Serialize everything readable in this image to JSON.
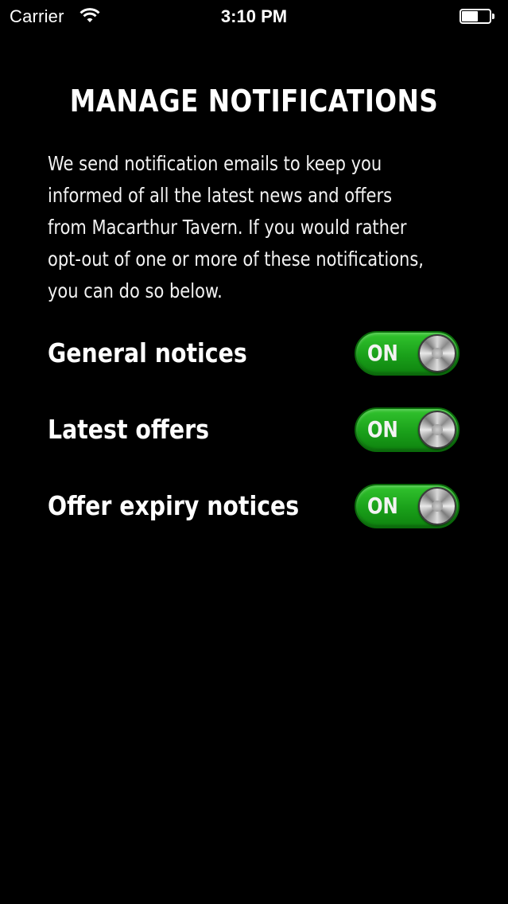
{
  "status_bar": {
    "carrier": "Carrier",
    "time": "3:10 PM",
    "wifi_icon": "wifi-icon",
    "battery_icon": "battery-icon",
    "battery_level_percent": 60
  },
  "page": {
    "title": "MANAGE NOTIFICATIONS",
    "intro_lines": [
      "We send notification emails to keep you",
      "informed of all the latest news and offers",
      "from Macarthur Tavern. If you would rather",
      "opt-out of one or more of these notifications,",
      "you can do so below."
    ]
  },
  "settings": [
    {
      "label": "General notices",
      "state": "ON",
      "enabled": true
    },
    {
      "label": "Latest offers",
      "state": "ON",
      "enabled": true
    },
    {
      "label": "Offer expiry notices",
      "state": "ON",
      "enabled": true
    }
  ],
  "colors": {
    "background": "#000000",
    "text": "#ffffff",
    "toggle_on": "#1aa01a"
  }
}
